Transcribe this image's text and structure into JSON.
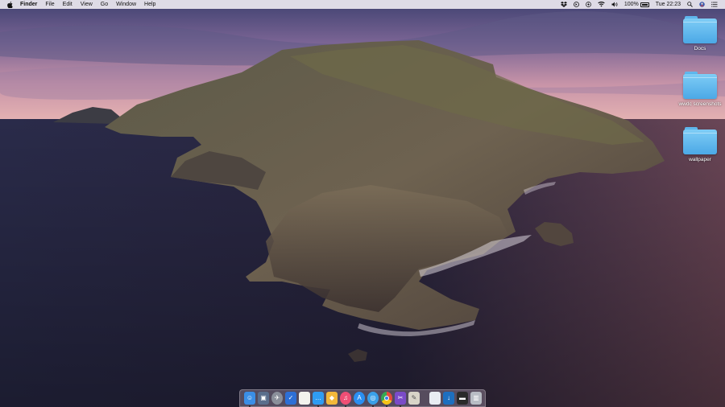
{
  "menubar": {
    "app_name": "Finder",
    "menus": [
      "File",
      "Edit",
      "View",
      "Go",
      "Window",
      "Help"
    ],
    "battery": "100%",
    "battery_level": 1.0,
    "clock": "Tue 22:23"
  },
  "desktop": {
    "folders": [
      {
        "label": "Docs"
      },
      {
        "label": "wwdc screenshots"
      },
      {
        "label": "wallpaper"
      }
    ]
  },
  "dock": {
    "apps": [
      {
        "icon": "finder-icon",
        "color": "#3a8ee6"
      },
      {
        "icon": "preview-icon",
        "color": "#5a6e8c"
      },
      {
        "icon": "launchpad-icon",
        "color": "#8a8f9a"
      },
      {
        "icon": "tasks-icon",
        "color": "#2d6fd6"
      },
      {
        "icon": "notes-icon",
        "color": "#f2f2ee"
      },
      {
        "icon": "messages-icon",
        "color": "#2f9cf3"
      },
      {
        "icon": "sketch-icon",
        "color": "#f2b83a"
      },
      {
        "icon": "music-icon",
        "color": "#f04e75"
      },
      {
        "icon": "app-store-icon",
        "color": "#2a8ff2"
      },
      {
        "icon": "safari-icon",
        "color": "#3aa0e8"
      },
      {
        "icon": "chrome-icon",
        "color": "#e8e8e8"
      },
      {
        "icon": "final-cut-icon",
        "color": "#7a4bc8"
      },
      {
        "icon": "script-editor-icon",
        "color": "#d8d4c8"
      }
    ],
    "others": [
      {
        "icon": "document-icon",
        "color": "#e8ecf2"
      },
      {
        "icon": "downloads-icon",
        "color": "#1d6fbf"
      },
      {
        "icon": "screen-icon",
        "color": "#2a2a2a"
      },
      {
        "icon": "trash-icon",
        "color": "#b8bcc4"
      }
    ]
  }
}
